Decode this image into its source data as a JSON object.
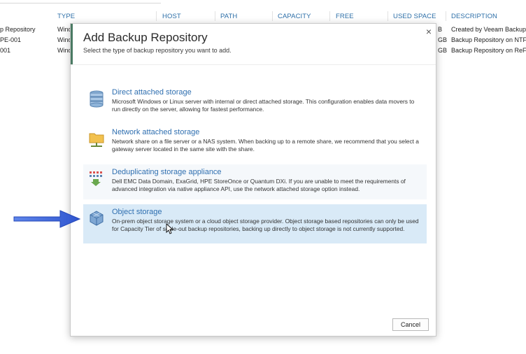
{
  "table": {
    "columns": [
      "TYPE",
      "HOST",
      "PATH",
      "CAPACITY",
      "FREE",
      "USED SPACE",
      "DESCRIPTION"
    ],
    "rows": [
      {
        "name": "p Repository",
        "type": "Wind",
        "used": "B",
        "description": "Created by Veeam Backup"
      },
      {
        "name": "PE-001",
        "type": "Wind",
        "used": "GB",
        "description": "Backup Repository on NTFS"
      },
      {
        "name": "001",
        "type": "Wind",
        "used": "GB",
        "description": "Backup Repository on ReFS"
      }
    ]
  },
  "dialog": {
    "title": "Add Backup Repository",
    "subtitle": "Select the type of backup repository you want to add.",
    "close_label": "×",
    "options": [
      {
        "title": "Direct attached storage",
        "description": "Microsoft Windows or Linux server with internal or direct attached storage. This configuration enables data movers to run directly on the server, allowing for fastest performance.",
        "icon": "database-stack-icon"
      },
      {
        "title": "Network attached storage",
        "description": "Network share on a file server or a NAS system. When backing up to a remote share, we recommend that you select a gateway server located in the same site with the share.",
        "icon": "network-folder-icon"
      },
      {
        "title": "Deduplicating storage appliance",
        "description": "Dell EMC Data Domain, ExaGrid, HPE StoreOnce or Quantum DXi. If you are unable to meet the requirements of advanced integration via native appliance API, use the network attached storage option instead.",
        "icon": "dedup-appliance-icon"
      },
      {
        "title": "Object storage",
        "description": "On-prem object storage system or a cloud object storage provider. Object storage based repositories can only be used for Capacity Tier of scale-out backup repositories, backing up directly to object storage is not currently supported.",
        "icon": "object-storage-cube-icon"
      }
    ],
    "cancel_label": "Cancel"
  },
  "colors": {
    "accent_green": "#4a7a63",
    "link_blue": "#2f6fb0",
    "selected_bg": "#d9eaf7",
    "arrow_blue": "#3a62d8"
  }
}
